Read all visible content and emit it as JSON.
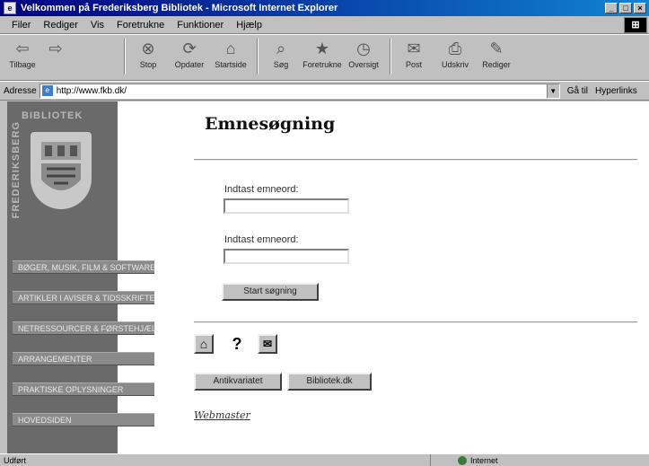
{
  "window": {
    "title": "Velkommen på Frederiksberg Bibliotek - Microsoft Internet Explorer",
    "buttons": [
      "_",
      "□",
      "×"
    ]
  },
  "menu": [
    "Filer",
    "Rediger",
    "Vis",
    "Foretrukne",
    "Funktioner",
    "Hjælp"
  ],
  "toolbar": {
    "items": [
      {
        "icon": "back-icon",
        "glyph": "⇦",
        "label": "Tilbage"
      },
      {
        "icon": "forward-icon",
        "glyph": "⇨",
        "label": ""
      },
      {
        "icon": "stop-icon",
        "glyph": "⊗",
        "label": "Stop"
      },
      {
        "icon": "refresh-icon",
        "glyph": "⟳",
        "label": "Opdater"
      },
      {
        "icon": "home-icon",
        "glyph": "⌂",
        "label": "Startside"
      },
      {
        "icon": "search-icon",
        "glyph": "⌕",
        "label": "Søg"
      },
      {
        "icon": "favorites-icon",
        "glyph": "★",
        "label": "Foretrukne"
      },
      {
        "icon": "history-icon",
        "glyph": "◷",
        "label": "Oversigt"
      },
      {
        "icon": "mail-icon",
        "glyph": "✉",
        "label": "Post"
      },
      {
        "icon": "print-icon",
        "glyph": "⎙",
        "label": "Udskriv"
      },
      {
        "icon": "edit-icon",
        "glyph": "✎",
        "label": "Rediger"
      }
    ]
  },
  "address": {
    "label": "Adresse",
    "url": "http://www.fkb.dk/",
    "go": "Gå til",
    "links": "Hyperlinks"
  },
  "sidebar": {
    "heading": "BIBLIOTEK",
    "vertical_text": "FREDERIKSBERG",
    "nav": [
      "BØGER, MUSIK, FILM & SOFTWARE",
      "ARTIKLER I AVISER & TIDSSKRIFTER",
      "NETRESSOURCER & FØRSTEHJÆLPEN",
      "ARRANGEMENTER",
      "PRAKTISKE OPLYSNINGER",
      "HOVEDSIDEN"
    ]
  },
  "main": {
    "title": "Emnesøgning",
    "field1_label": "Indtast emneord:",
    "field2_label": "Indtast emneord:",
    "search_button": "Start søgning",
    "bottom_buttons": [
      "Antikvariatet",
      "Bibliotek.dk"
    ],
    "link": "Webmaster"
  },
  "status": {
    "left": "Udført",
    "zone": "Internet"
  }
}
